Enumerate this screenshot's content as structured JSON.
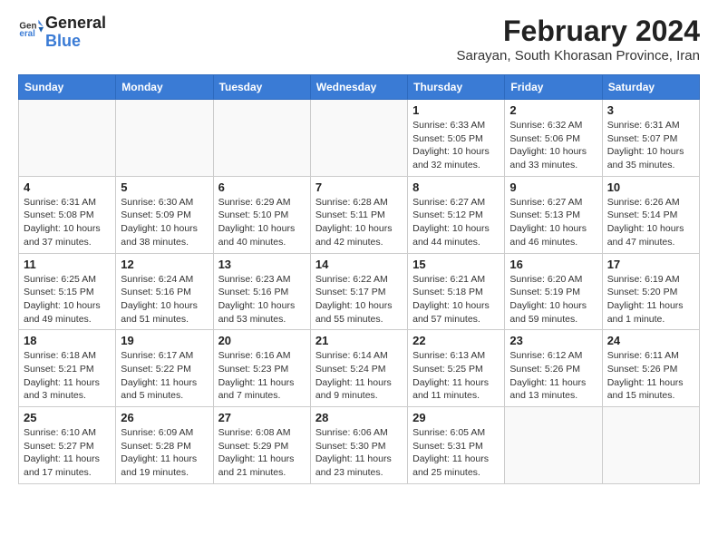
{
  "header": {
    "logo_general": "General",
    "logo_blue": "Blue",
    "month_year": "February 2024",
    "location": "Sarayan, South Khorasan Province, Iran"
  },
  "days_of_week": [
    "Sunday",
    "Monday",
    "Tuesday",
    "Wednesday",
    "Thursday",
    "Friday",
    "Saturday"
  ],
  "weeks": [
    [
      {
        "day": "",
        "info": ""
      },
      {
        "day": "",
        "info": ""
      },
      {
        "day": "",
        "info": ""
      },
      {
        "day": "",
        "info": ""
      },
      {
        "day": "1",
        "sunrise": "6:33 AM",
        "sunset": "5:05 PM",
        "daylight": "10 hours and 32 minutes."
      },
      {
        "day": "2",
        "sunrise": "6:32 AM",
        "sunset": "5:06 PM",
        "daylight": "10 hours and 33 minutes."
      },
      {
        "day": "3",
        "sunrise": "6:31 AM",
        "sunset": "5:07 PM",
        "daylight": "10 hours and 35 minutes."
      }
    ],
    [
      {
        "day": "4",
        "sunrise": "6:31 AM",
        "sunset": "5:08 PM",
        "daylight": "10 hours and 37 minutes."
      },
      {
        "day": "5",
        "sunrise": "6:30 AM",
        "sunset": "5:09 PM",
        "daylight": "10 hours and 38 minutes."
      },
      {
        "day": "6",
        "sunrise": "6:29 AM",
        "sunset": "5:10 PM",
        "daylight": "10 hours and 40 minutes."
      },
      {
        "day": "7",
        "sunrise": "6:28 AM",
        "sunset": "5:11 PM",
        "daylight": "10 hours and 42 minutes."
      },
      {
        "day": "8",
        "sunrise": "6:27 AM",
        "sunset": "5:12 PM",
        "daylight": "10 hours and 44 minutes."
      },
      {
        "day": "9",
        "sunrise": "6:27 AM",
        "sunset": "5:13 PM",
        "daylight": "10 hours and 46 minutes."
      },
      {
        "day": "10",
        "sunrise": "6:26 AM",
        "sunset": "5:14 PM",
        "daylight": "10 hours and 47 minutes."
      }
    ],
    [
      {
        "day": "11",
        "sunrise": "6:25 AM",
        "sunset": "5:15 PM",
        "daylight": "10 hours and 49 minutes."
      },
      {
        "day": "12",
        "sunrise": "6:24 AM",
        "sunset": "5:16 PM",
        "daylight": "10 hours and 51 minutes."
      },
      {
        "day": "13",
        "sunrise": "6:23 AM",
        "sunset": "5:16 PM",
        "daylight": "10 hours and 53 minutes."
      },
      {
        "day": "14",
        "sunrise": "6:22 AM",
        "sunset": "5:17 PM",
        "daylight": "10 hours and 55 minutes."
      },
      {
        "day": "15",
        "sunrise": "6:21 AM",
        "sunset": "5:18 PM",
        "daylight": "10 hours and 57 minutes."
      },
      {
        "day": "16",
        "sunrise": "6:20 AM",
        "sunset": "5:19 PM",
        "daylight": "10 hours and 59 minutes."
      },
      {
        "day": "17",
        "sunrise": "6:19 AM",
        "sunset": "5:20 PM",
        "daylight": "11 hours and 1 minute."
      }
    ],
    [
      {
        "day": "18",
        "sunrise": "6:18 AM",
        "sunset": "5:21 PM",
        "daylight": "11 hours and 3 minutes."
      },
      {
        "day": "19",
        "sunrise": "6:17 AM",
        "sunset": "5:22 PM",
        "daylight": "11 hours and 5 minutes."
      },
      {
        "day": "20",
        "sunrise": "6:16 AM",
        "sunset": "5:23 PM",
        "daylight": "11 hours and 7 minutes."
      },
      {
        "day": "21",
        "sunrise": "6:14 AM",
        "sunset": "5:24 PM",
        "daylight": "11 hours and 9 minutes."
      },
      {
        "day": "22",
        "sunrise": "6:13 AM",
        "sunset": "5:25 PM",
        "daylight": "11 hours and 11 minutes."
      },
      {
        "day": "23",
        "sunrise": "6:12 AM",
        "sunset": "5:26 PM",
        "daylight": "11 hours and 13 minutes."
      },
      {
        "day": "24",
        "sunrise": "6:11 AM",
        "sunset": "5:26 PM",
        "daylight": "11 hours and 15 minutes."
      }
    ],
    [
      {
        "day": "25",
        "sunrise": "6:10 AM",
        "sunset": "5:27 PM",
        "daylight": "11 hours and 17 minutes."
      },
      {
        "day": "26",
        "sunrise": "6:09 AM",
        "sunset": "5:28 PM",
        "daylight": "11 hours and 19 minutes."
      },
      {
        "day": "27",
        "sunrise": "6:08 AM",
        "sunset": "5:29 PM",
        "daylight": "11 hours and 21 minutes."
      },
      {
        "day": "28",
        "sunrise": "6:06 AM",
        "sunset": "5:30 PM",
        "daylight": "11 hours and 23 minutes."
      },
      {
        "day": "29",
        "sunrise": "6:05 AM",
        "sunset": "5:31 PM",
        "daylight": "11 hours and 25 minutes."
      },
      {
        "day": "",
        "info": ""
      },
      {
        "day": "",
        "info": ""
      }
    ]
  ]
}
